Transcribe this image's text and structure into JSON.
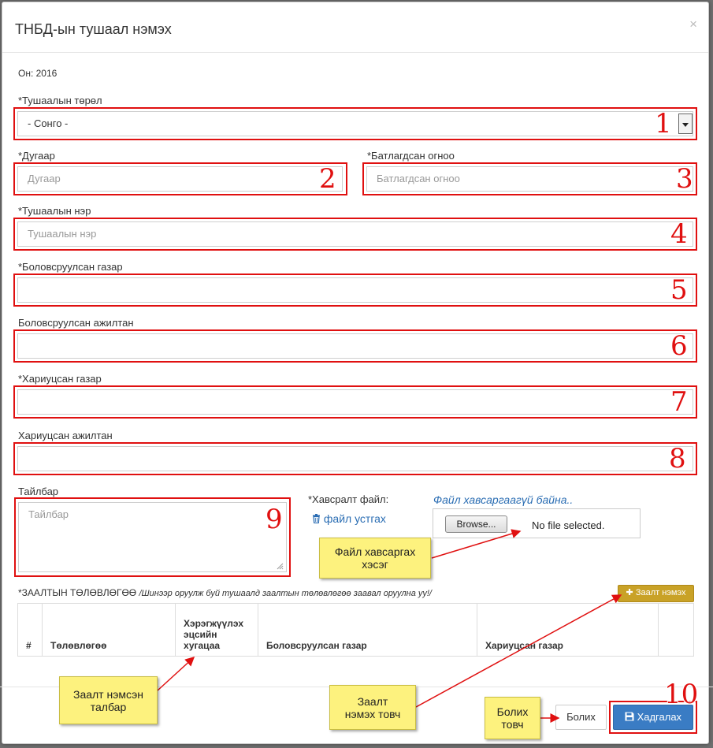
{
  "modal": {
    "title": "ТНБД-ын тушаал нэмэх",
    "close": "×"
  },
  "year": "Он: 2016",
  "fields": {
    "order_type": {
      "label": "*Тушаалын төрөл",
      "value": "- Сонго -"
    },
    "number": {
      "label": "*Дугаар",
      "placeholder": "Дугаар"
    },
    "approved_date": {
      "label": "*Батлагдсан огноо",
      "placeholder": "Батлагдсан огноо"
    },
    "order_name": {
      "label": "*Тушаалын нэр",
      "placeholder": "Тушаалын нэр"
    },
    "prepared_org": {
      "label": "*Боловсруулсан газар",
      "value": ""
    },
    "prepared_staff": {
      "label": "Боловсруулсан ажилтан",
      "value": ""
    },
    "responsible_org": {
      "label": "*Хариуцсан газар",
      "value": ""
    },
    "responsible_staff": {
      "label": "Хариуцсан ажилтан",
      "value": ""
    },
    "description": {
      "label": "Тайлбар",
      "placeholder": "Тайлбар"
    }
  },
  "attachment": {
    "label": "*Хавсралт файл:",
    "status": "Файл хавсаргаагүй байна..",
    "delete_link": "файл устгах",
    "browse": "Browse...",
    "no_file": "No file selected."
  },
  "plan": {
    "heading": "*ЗААЛТЫН ТӨЛӨВЛӨГӨӨ",
    "note": "/Шинээр оруулж буй тушаалд заалтын төлөвлөгөө заавал оруулна уу!/",
    "add_button": "Заалт нэмэх",
    "columns": [
      "#",
      "Төлөвлөгөө",
      "Хэрэгжүүлэх эцсийн хугацаа",
      "Боловсруулсан газар",
      "Хариуцсан газар",
      ""
    ]
  },
  "buttons": {
    "cancel": "Болих",
    "save": "Хадгалах"
  },
  "annotations": {
    "numbers": [
      "1",
      "2",
      "3",
      "4",
      "5",
      "6",
      "7",
      "8",
      "9",
      "10"
    ],
    "callout_file": "Файл хавсаргах\nхэсэг",
    "callout_field": "Заалт нэмсэн\nталбар",
    "callout_add": "Заалт\nнэмэх товч",
    "callout_cancel": "Болих\nтовч"
  },
  "colors": {
    "annotation_red": "#e01010",
    "callout_yellow": "#fdf27e",
    "primary": "#3a7cc4",
    "warning": "#c9a227",
    "link": "#2a6db3"
  }
}
